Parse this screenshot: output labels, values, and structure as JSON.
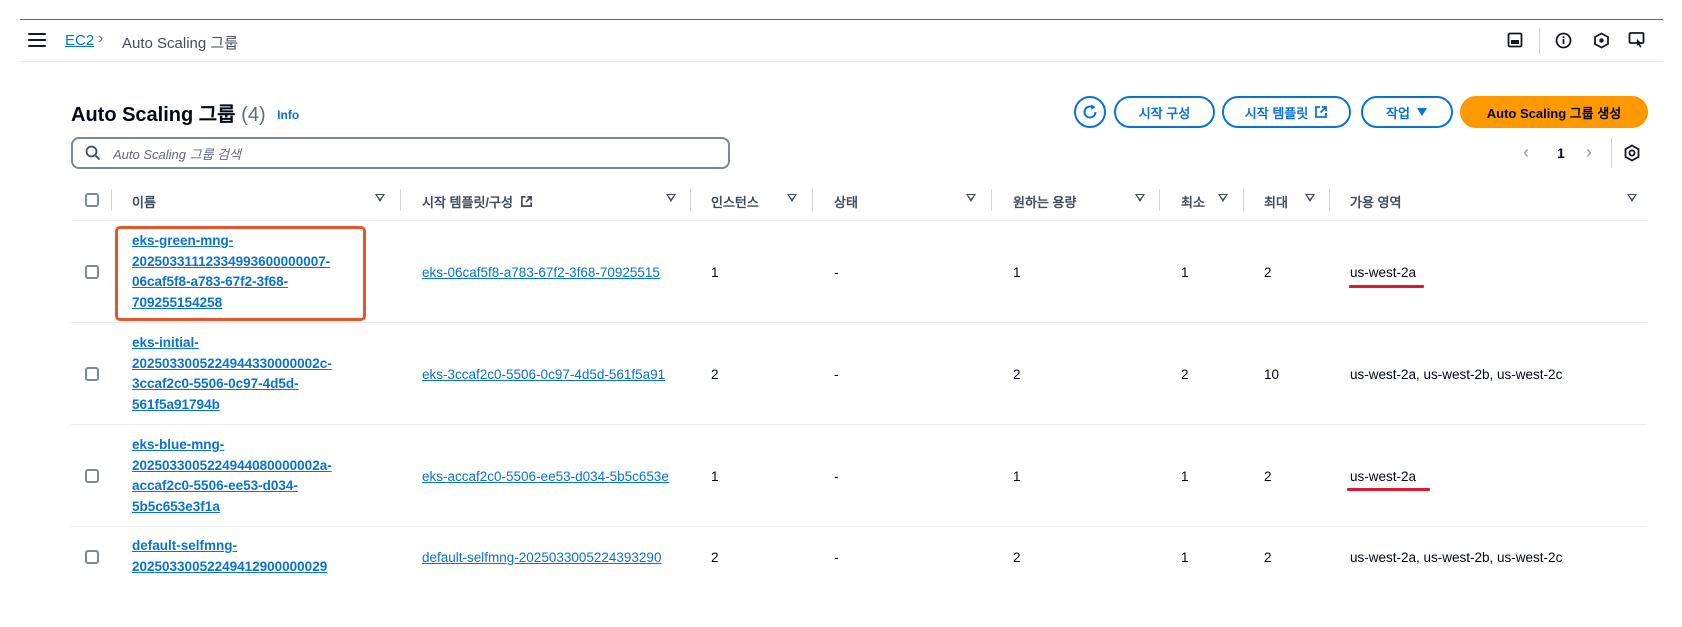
{
  "breadcrumb": {
    "root": "EC2",
    "current": "Auto Scaling 그룹"
  },
  "page": {
    "title": "Auto Scaling 그룹",
    "count": "(4)",
    "info": "Info"
  },
  "actions": {
    "launch_config": "시작 구성",
    "launch_template": "시작 템플릿",
    "actions": "작업",
    "create": "Auto Scaling 그룹 생성"
  },
  "search": {
    "placeholder": "Auto Scaling 그룹 검색",
    "value": ""
  },
  "pagination": {
    "current_page": "1"
  },
  "columns": {
    "name": "이름",
    "template": "시작 템플릿/구성",
    "instances": "인스턴스",
    "status": "상태",
    "desired": "원하는 용량",
    "min": "최소",
    "max": "최대",
    "az": "가용 영역"
  },
  "rows": [
    {
      "name": "eks-green-mng-\n20250331112334993600000007-\n06caf5f8-a783-67f2-3f68-\n709255154258",
      "template": "eks-06caf5f8-a783-67f2-3f68-70925515",
      "instances": "1",
      "status": "-",
      "desired": "1",
      "min": "1",
      "max": "2",
      "az": "us-west-2a"
    },
    {
      "name": "eks-initial-\n2025033005224944330000002c-\n3ccaf2c0-5506-0c97-4d5d-\n561f5a91794b",
      "template": "eks-3ccaf2c0-5506-0c97-4d5d-561f5a91",
      "instances": "2",
      "status": "-",
      "desired": "2",
      "min": "2",
      "max": "10",
      "az": "us-west-2a, us-west-2b, us-west-2c"
    },
    {
      "name": "eks-blue-mng-\n2025033005224944080000002a-\naccaf2c0-5506-ee53-d034-\n5b5c653e3f1a",
      "template": "eks-accaf2c0-5506-ee53-d034-5b5c653e",
      "instances": "1",
      "status": "-",
      "desired": "1",
      "min": "1",
      "max": "2",
      "az": "us-west-2a"
    },
    {
      "name": "default-selfmng-\n20250330052249412900000029",
      "template": "default-selfmng-2025033005224393290",
      "instances": "2",
      "status": "-",
      "desired": "2",
      "min": "1",
      "max": "2",
      "az": "us-west-2a, us-west-2b, us-west-2c"
    }
  ],
  "colors": {
    "link": "#0972d3",
    "primary": "#ff9900",
    "highlight": "#e8542c",
    "underline": "#e0182d"
  },
  "icons": [
    "menu-icon",
    "chevron-right-icon",
    "panel-icon",
    "info-circle-icon",
    "notifications-icon",
    "feedback-icon",
    "search-icon",
    "refresh-icon",
    "external-link-icon",
    "caret-down-icon",
    "chevron-left-icon",
    "settings-icon"
  ]
}
